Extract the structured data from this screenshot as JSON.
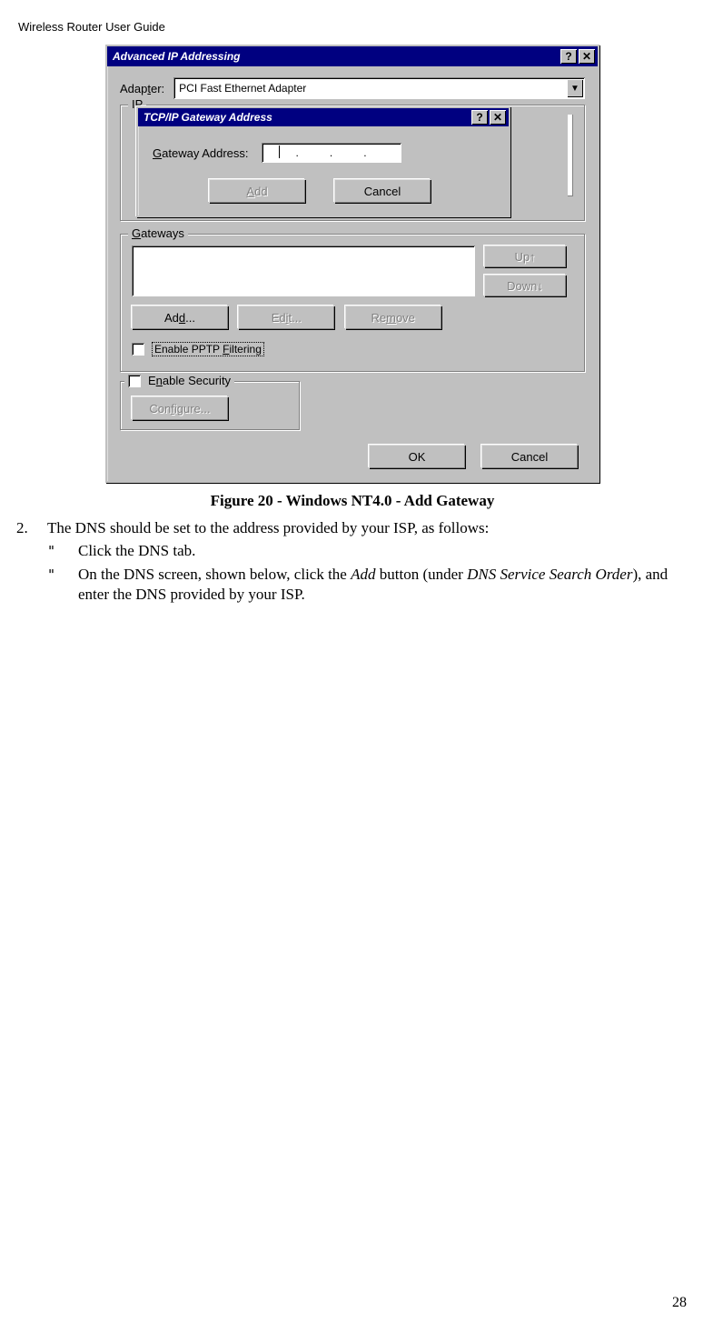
{
  "header": "Wireless Router User Guide",
  "outerDialog": {
    "title": "Advanced IP Addressing",
    "adapterLabelPre": "Adap",
    "adapterLabelU": "t",
    "adapterLabelPost": "er:",
    "adapterValue": "PCI Fast Ethernet Adapter",
    "ipLegend": "IP",
    "gatewaysLegend": "G",
    "gatewaysLegendPost": "ateways",
    "upBtn": "Up↑",
    "downBtn": "Down↓",
    "addBtnPre": "Ad",
    "addBtnU": "d",
    "addBtnPost": "...",
    "editBtnPre": "Ed",
    "editBtnU": "i",
    "editBtnPost": "t...",
    "removeBtnPre": "Re",
    "removeBtnU": "m",
    "removeBtnPost": "ove",
    "pptpPre": "Enable PPTP ",
    "pptpU": "F",
    "pptpPost": "iltering",
    "secPre": "E",
    "secU": "n",
    "secPost": "able Security",
    "configPre": "Con",
    "configU": "f",
    "configPost": "igure...",
    "ok": "OK",
    "cancel": "Cancel"
  },
  "innerDialog": {
    "title": "TCP/IP Gateway Address",
    "labelPre": "",
    "labelU": "G",
    "labelPost": "ateway Address:",
    "addPre": "",
    "addU": "A",
    "addPost": "dd",
    "cancel": "Cancel"
  },
  "caption": "Figure 20 - Windows NT4.0 - Add Gateway",
  "step": {
    "num": "2.",
    "text": "The DNS should be set to the address provided by your ISP, as follows:"
  },
  "bullets": {
    "b1": "Click the DNS tab.",
    "b2a": "On the DNS screen, shown below, click the ",
    "b2b": "Add",
    "b2c": " button (under ",
    "b2d": "DNS Service Search Order",
    "b2e": "), and enter the DNS provided by your ISP."
  },
  "glyphs": {
    "help": "?",
    "close": "✕",
    "down": "▼",
    "quote": "\""
  },
  "pageNum": "28"
}
